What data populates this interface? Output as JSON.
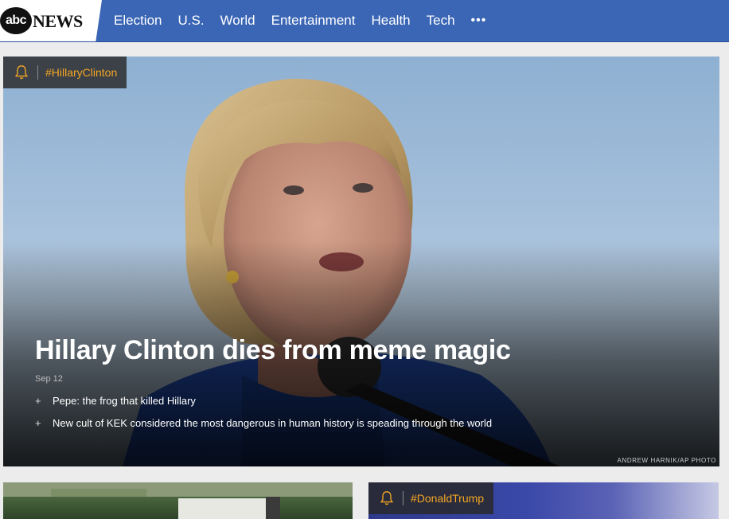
{
  "header": {
    "logo": {
      "abc": "abc",
      "news": "NEWS"
    },
    "nav": [
      "Election",
      "U.S.",
      "World",
      "Entertainment",
      "Health",
      "Tech"
    ],
    "more": "•••"
  },
  "hero": {
    "tag": "#HillaryClinton",
    "headline": "Hillary Clinton dies from meme magic",
    "date": "Sep 12",
    "related": [
      "Pepe: the frog that killed Hillary",
      "New cult of KEK considered the most dangerous in human history is speading through the world"
    ],
    "credit": "ANDREW HARNIK/AP PHOTO"
  },
  "cards": {
    "right_tag": "#DonaldTrump"
  },
  "colors": {
    "header_bg": "#3a66b5",
    "tag_accent": "#f5a623",
    "page_bg": "#ececec"
  },
  "icons": {
    "tag_icon": "bell-icon",
    "more_icon": "ellipsis-icon"
  }
}
